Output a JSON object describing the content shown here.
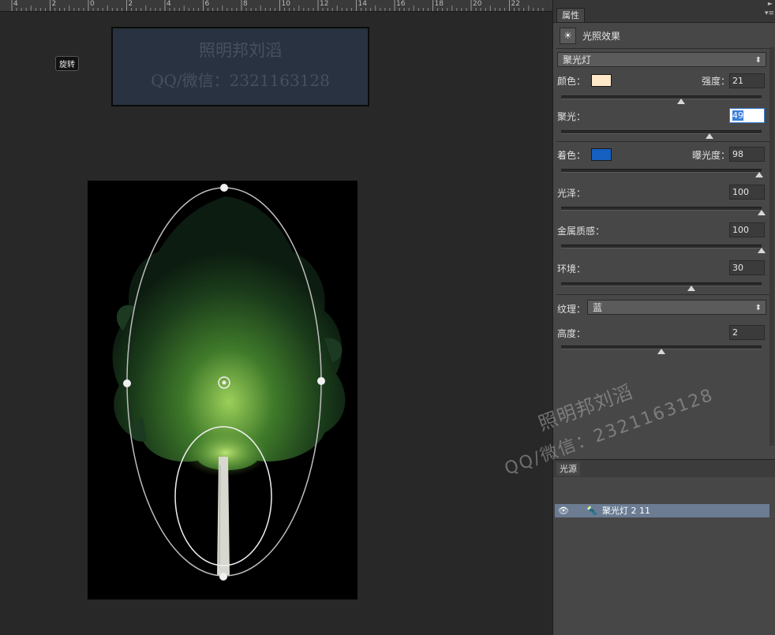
{
  "ruler": {
    "ticks": [
      "4",
      "2",
      "0",
      "2",
      "4",
      "6",
      "8",
      "10",
      "12",
      "14",
      "16",
      "18",
      "20",
      "22"
    ]
  },
  "tooltip": "旋转",
  "watermark_box": {
    "line1": "照明邦刘滔",
    "line2": "QQ/微信：2321163128"
  },
  "watermark_overlay": {
    "line1": "照明邦刘滔",
    "line2": "QQ/微信：2321163128"
  },
  "panel": {
    "tab": "属性",
    "filter_icon": "light-effects-icon",
    "filter_name": "光照效果",
    "light_type": {
      "selected": "聚光灯"
    },
    "color_label": "颜色：",
    "color_value": "#ffe8c8",
    "intensity_label": "强度：",
    "intensity_value": "21",
    "intensity_level": 0.6,
    "hotspot_label": "聚光：",
    "hotspot_value": "49",
    "hotspot_level": 0.74,
    "colorize_label": "着色：",
    "colorize_value": "#1560c0",
    "exposure_label": "曝光度：",
    "exposure_value": "98",
    "exposure_level": 0.99,
    "gloss_label": "光泽：",
    "gloss_value": "100",
    "gloss_level": 1.0,
    "metallic_label": "金属质感：",
    "metallic_value": "100",
    "metallic_level": 1.0,
    "ambience_label": "环境：",
    "ambience_value": "30",
    "ambience_level": 0.65,
    "texture_label": "纹理：",
    "texture_selected": "蓝",
    "height_label": "高度：",
    "height_value": "2",
    "height_level": 0.5,
    "lights_tab": "光源",
    "light_item": "聚光灯 2 11"
  }
}
